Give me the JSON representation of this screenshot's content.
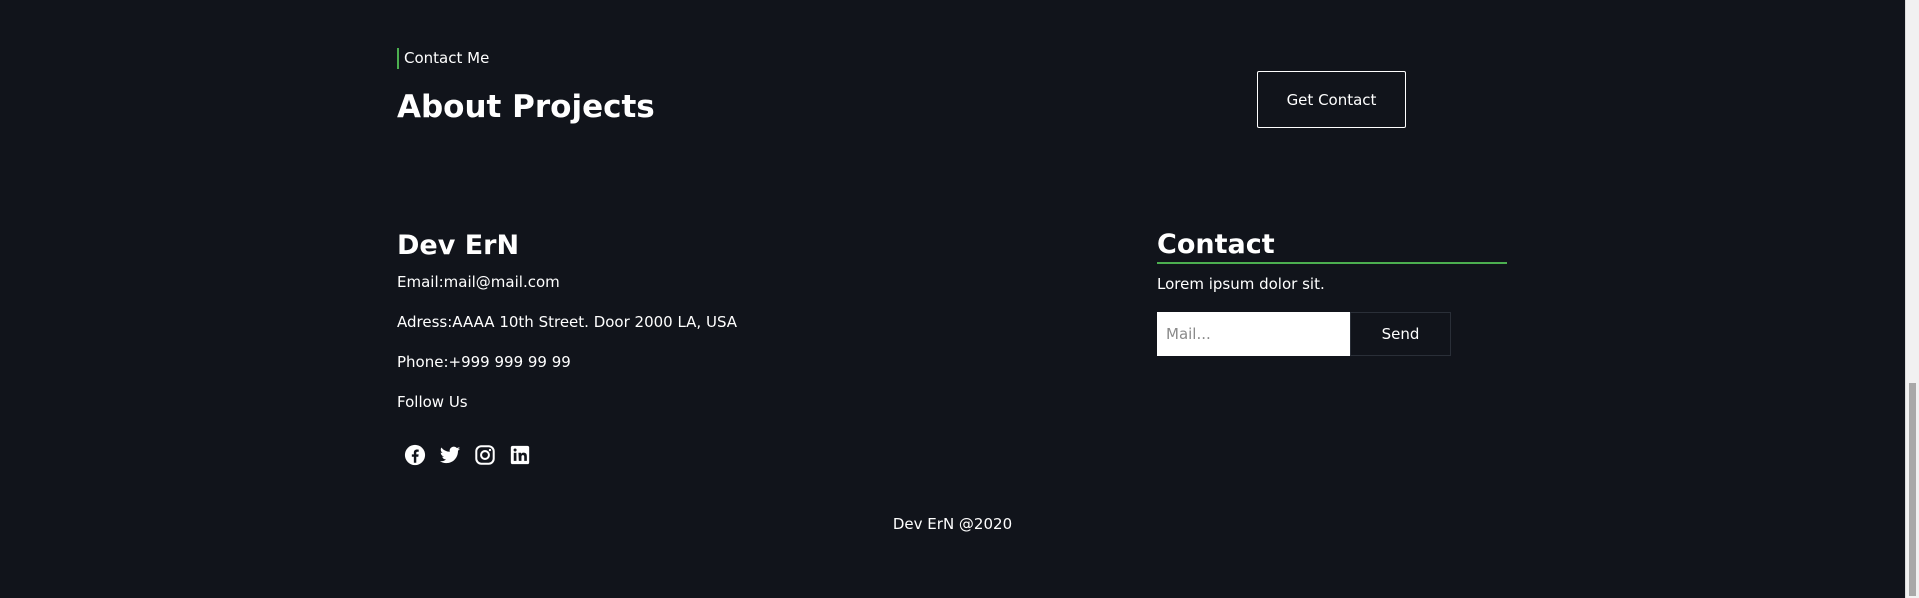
{
  "hero": {
    "eyebrow": "Contact Me",
    "title": "About Projects",
    "cta_label": "Get Contact"
  },
  "footer": {
    "brand": "Dev ErN",
    "email": "Email:mail@mail.com",
    "address": "Adress:AAAA 10th Street. Door 2000 LA, USA",
    "phone": "Phone:+999 999 99 99",
    "follow_label": "Follow Us",
    "socials": [
      {
        "icon": "facebook-icon"
      },
      {
        "icon": "twitter-icon"
      },
      {
        "icon": "instagram-icon"
      },
      {
        "icon": "linkedin-icon"
      }
    ],
    "contact": {
      "title": "Contact",
      "description": "Lorem ipsum dolor sit.",
      "input_placeholder": "Mail...",
      "input_value": "",
      "send_label": "Send"
    },
    "copyright": "Dev ErN @2020"
  },
  "colors": {
    "background": "#11141b",
    "accent": "#4caf50",
    "text": "#ffffff"
  }
}
